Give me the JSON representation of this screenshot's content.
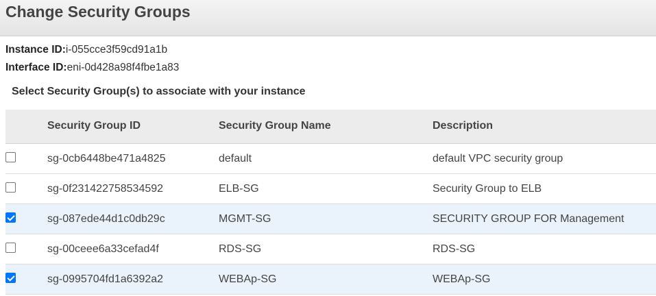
{
  "dialog": {
    "title": "Change Security Groups"
  },
  "instance": {
    "id_label": "Instance ID:",
    "id_value": "i-055cce3f59cd91a1b",
    "interface_label": "Interface ID:",
    "interface_value": "eni-0d428a98f4fbe1a83"
  },
  "instruction": "Select Security Group(s) to associate with your instance",
  "table": {
    "headers": {
      "id": "Security Group ID",
      "name": "Security Group Name",
      "description": "Description"
    },
    "rows": [
      {
        "checked": false,
        "id": "sg-0cb6448be471a4825",
        "name": "default",
        "description": "default VPC security group"
      },
      {
        "checked": false,
        "id": "sg-0f231422758534592",
        "name": "ELB-SG",
        "description": "Security Group to ELB"
      },
      {
        "checked": true,
        "id": "sg-087ede44d1c0db29c",
        "name": "MGMT-SG",
        "description": "SECURITY GROUP FOR Management"
      },
      {
        "checked": false,
        "id": "sg-00ceee6a33cefad4f",
        "name": "RDS-SG",
        "description": "RDS-SG"
      },
      {
        "checked": true,
        "id": "sg-0995704fd1a6392a2",
        "name": "WEBAp-SG",
        "description": "WEBAp-SG"
      }
    ]
  },
  "colors": {
    "selected_row": "#eaf3fb",
    "checkbox_accent": "#0075ff",
    "header_bg": "#ececec"
  }
}
